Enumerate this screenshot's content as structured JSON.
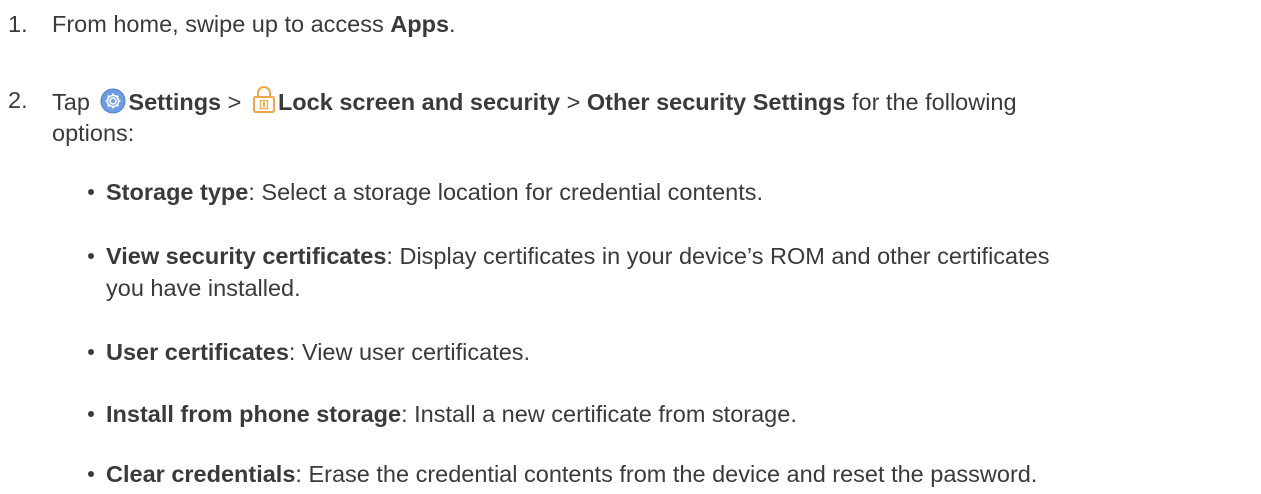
{
  "steps": [
    {
      "num": "1.",
      "pre": "From home, swipe up to access ",
      "bold": "Apps",
      "post": "."
    },
    {
      "num": "2.",
      "tap": "Tap ",
      "settings": "Settings",
      "sep1": " > ",
      "lock": "Lock screen and security",
      "sep2": " > ",
      "other": "Other security Settings",
      "post_line1": " for the following",
      "line2": "options:"
    }
  ],
  "options": [
    {
      "title": "Storage type",
      "desc": ": Select a storage location for credential contents."
    },
    {
      "title": "View security certificates",
      "desc": ": Display certificates in your device’s ROM and other certificates",
      "desc2": "you have installed."
    },
    {
      "title": "User certificates",
      "desc": ": View user certificates."
    },
    {
      "title": "Install from phone storage",
      "desc": ": Install a new certificate from storage."
    },
    {
      "title": "Clear credentials",
      "desc": ": Erase the credential contents from the device and reset the password."
    }
  ],
  "icons": {
    "settings": "settings-gear-icon",
    "lock": "lock-icon",
    "settings_color": "#5b8fd6",
    "lock_color": "#f0a64a"
  }
}
